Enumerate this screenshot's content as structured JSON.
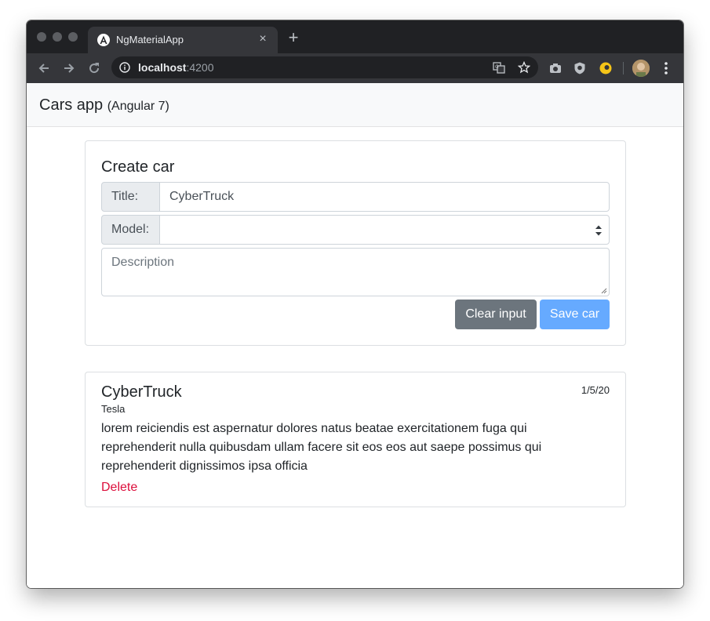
{
  "browser": {
    "tab_title": "NgMaterialApp",
    "tab_close": "×",
    "new_tab": "+",
    "url_host": "localhost",
    "url_port": ":4200"
  },
  "app": {
    "brand": "Cars app",
    "brand_sub": "(Angular 7)"
  },
  "create_form": {
    "heading": "Create car",
    "title_label": "Title:",
    "title_value": "CyberTruck",
    "model_label": "Model:",
    "model_value": "",
    "description_placeholder": "Description",
    "clear_label": "Clear input",
    "save_label": "Save car"
  },
  "cars": [
    {
      "title": "CyberTruck",
      "date": "1/5/20",
      "model": "Tesla",
      "description": "lorem reiciendis est aspernatur dolores natus beatae exercitationem fuga qui reprehenderit nulla quibusdam ullam facere sit eos eos aut saepe possimus qui reprehenderit dignissimos ipsa officia",
      "delete_label": "Delete"
    }
  ],
  "colors": {
    "save_button": "#66aaff",
    "clear_button": "#6c757d",
    "delete_link": "#dc0f3c",
    "navbar_bg": "#f8f9fa",
    "browser_chrome": "#35363a"
  },
  "icons": {
    "tab_favicon": "angular-logo-icon",
    "back": "back-arrow-icon",
    "forward": "forward-arrow-icon",
    "reload": "reload-icon",
    "site_info": "info-icon",
    "translate": "translate-icon",
    "bookmark": "star-icon",
    "ext1": "camera-icon",
    "ext2": "shield-icon",
    "ext3": "yellow-circle-icon",
    "menu": "kebab-menu-icon"
  }
}
